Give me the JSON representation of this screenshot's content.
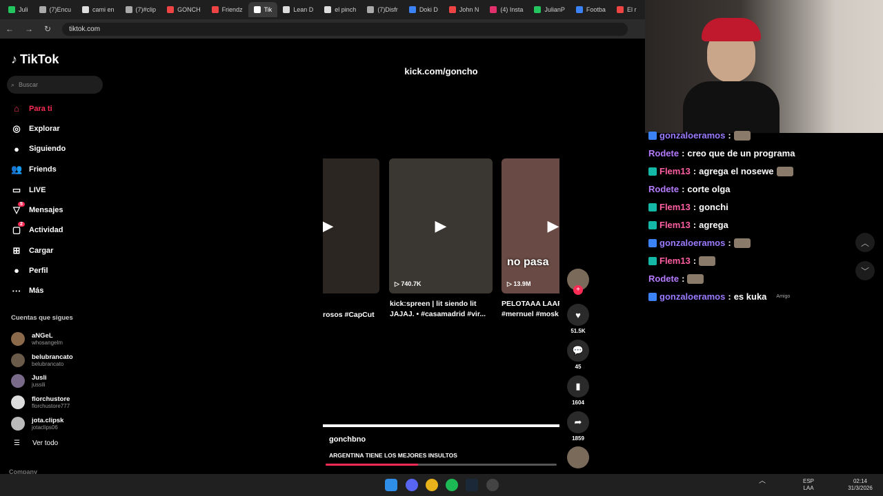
{
  "browser": {
    "tabs": [
      "Juli",
      "(7)Encu",
      "cami en",
      "(7)#clip",
      "GONCH",
      "Friendz",
      "Tik",
      "Lean D",
      "el pinch",
      "(7)Disfr",
      "Doki D",
      "John N",
      "(4) Insta",
      "JulianP",
      "Footba",
      "El r"
    ],
    "url": "tiktok.com"
  },
  "sidebar": {
    "logo": "TikTok",
    "search_placeholder": "Buscar",
    "nav": [
      {
        "label": "Para ti",
        "icon": "home-icon"
      },
      {
        "label": "Explorar",
        "icon": "compass-icon"
      },
      {
        "label": "Siguiendo",
        "icon": "following-icon"
      },
      {
        "label": "Friends",
        "icon": "friends-icon"
      },
      {
        "label": "LIVE",
        "icon": "live-icon"
      },
      {
        "label": "Mensajes",
        "icon": "messages-icon",
        "badge": "5"
      },
      {
        "label": "Actividad",
        "icon": "activity-icon",
        "badge": "2"
      },
      {
        "label": "Cargar",
        "icon": "upload-icon"
      },
      {
        "label": "Perfil",
        "icon": "profile-icon"
      },
      {
        "label": "Más",
        "icon": "more-icon"
      }
    ],
    "following_title": "Cuentas que sigues",
    "accounts": [
      {
        "name": "aNGeL",
        "handle": "whosangelm"
      },
      {
        "name": "belubrancato",
        "handle": "belubrancato"
      },
      {
        "name": "Jusli",
        "handle": "jussili"
      },
      {
        "name": "florchustore",
        "handle": "florchustore777"
      },
      {
        "name": "jota.clipsk",
        "handle": "jotaclips06"
      }
    ],
    "see_all": "Ver todo",
    "company": "Company"
  },
  "video": {
    "overlay_text": "kick.com/goncho",
    "cards": [
      {
        "caption1": "rosos #CapCut",
        "caption2": "",
        "views": ""
      },
      {
        "caption1": "kick:spreen | lit siendo lit",
        "caption2": "JAJAJ. • #casamadrid #vir...",
        "views": "740.7K"
      },
      {
        "caption1": "PELOTAAA LAAR",
        "caption2": "#mernuel #mosk",
        "views": "13.9M",
        "overlay": "no pasa"
      }
    ],
    "author": "gonchbno",
    "description": "ARGENTINA TIENE LOS MEJORES INSULTOS",
    "progress": 0.4
  },
  "actions": {
    "likes": "51.5K",
    "comments": "45",
    "saves": "1604",
    "shares": "1859"
  },
  "chat": {
    "messages": [
      {
        "user": "gonzaloeramos",
        "text": "",
        "color": "#9b7bff",
        "badge": "#3b82f6",
        "emote": true
      },
      {
        "user": "Rodete",
        "text": "creo que de un programa",
        "color": "#b57bff",
        "badge": "",
        "emote": false
      },
      {
        "user": "Flem13",
        "text": "agrega el nosewe",
        "color": "#ff5fa2",
        "badge": "#14b8a6",
        "emote": true
      },
      {
        "user": "Rodete",
        "text": "corte olga",
        "color": "#b57bff",
        "badge": "",
        "emote": false
      },
      {
        "user": "Flem13",
        "text": "gonchi",
        "color": "#ff5fa2",
        "badge": "#14b8a6",
        "emote": false
      },
      {
        "user": "Flem13",
        "text": "agrega",
        "color": "#ff5fa2",
        "badge": "#14b8a6",
        "emote": false
      },
      {
        "user": "gonzaloeramos",
        "text": "",
        "color": "#9b7bff",
        "badge": "#3b82f6",
        "emote": true
      },
      {
        "user": "Flem13",
        "text": "",
        "color": "#ff5fa2",
        "badge": "#14b8a6",
        "emote": true
      },
      {
        "user": "Rodete",
        "text": "",
        "color": "#b57bff",
        "badge": "",
        "emote": true
      },
      {
        "user": "gonzaloeramos",
        "text": "es kuka",
        "color": "#9b7bff",
        "badge": "#3b82f6",
        "emote": false,
        "tag": "Amigo"
      }
    ]
  },
  "taskbar": {
    "lang": "ESP",
    "lang2": "LAA",
    "time": "02:14",
    "date": "31/3/2026"
  }
}
